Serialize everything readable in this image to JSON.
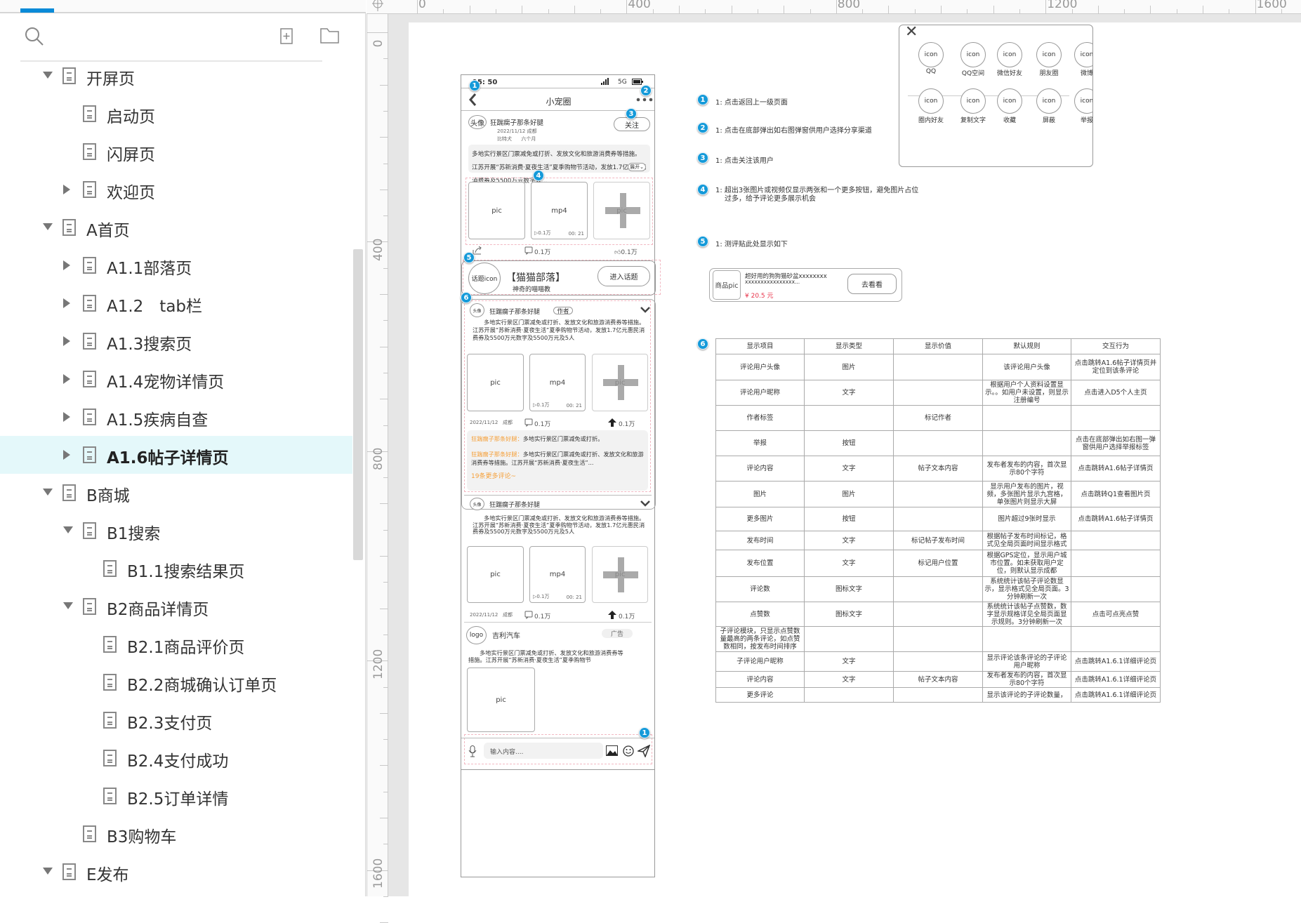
{
  "sidebar": {
    "items": [
      {
        "label": "开屏页",
        "level": 0,
        "state": "expanded"
      },
      {
        "label": "启动页",
        "level": 1,
        "state": "leaf"
      },
      {
        "label": "闪屏页",
        "level": 1,
        "state": "leaf"
      },
      {
        "label": "欢迎页",
        "level": 1,
        "state": "collapsed"
      },
      {
        "label": "A首页",
        "level": 0,
        "state": "expanded"
      },
      {
        "label": "A1.1部落页",
        "level": 1,
        "state": "collapsed"
      },
      {
        "label": "A1.2　tab栏",
        "level": 1,
        "state": "collapsed"
      },
      {
        "label": "A1.3搜索页",
        "level": 1,
        "state": "collapsed"
      },
      {
        "label": "A1.4宠物详情页",
        "level": 1,
        "state": "collapsed"
      },
      {
        "label": "A1.5疾病自查",
        "level": 1,
        "state": "collapsed"
      },
      {
        "label": "A1.6帖子详情页",
        "level": 1,
        "state": "collapsed",
        "selected": true
      },
      {
        "label": "B商城",
        "level": 0,
        "state": "expanded"
      },
      {
        "label": "B1搜索",
        "level": 1,
        "state": "expanded"
      },
      {
        "label": "B1.1搜索结果页",
        "level": 2,
        "state": "leaf"
      },
      {
        "label": "B2商品详情页",
        "level": 1,
        "state": "expanded"
      },
      {
        "label": "B2.1商品评价页",
        "level": 2,
        "state": "leaf"
      },
      {
        "label": "B2.2商城确认订单页",
        "level": 2,
        "state": "leaf"
      },
      {
        "label": "B2.3支付页",
        "level": 2,
        "state": "leaf"
      },
      {
        "label": "B2.4支付成功",
        "level": 2,
        "state": "leaf"
      },
      {
        "label": "B2.5订单详情",
        "level": 2,
        "state": "leaf"
      },
      {
        "label": "B3购物车",
        "level": 1,
        "state": "leaf"
      },
      {
        "label": "E发布",
        "level": 0,
        "state": "expanded"
      }
    ]
  },
  "rulers": {
    "top": [
      "0",
      "400",
      "800",
      "1200",
      "1600"
    ],
    "left": [
      "0",
      "400",
      "800",
      "1200",
      "1600"
    ]
  },
  "phone": {
    "time": "15: 50",
    "network": "5G",
    "title": "小宠圈",
    "post": {
      "avatar": "头像",
      "name": "狂踹瘸子那条好腿",
      "date": "2022/11/12  成都",
      "pet": "比特犬      六个月",
      "follow": "关注",
      "text": "多地实行景区门票减免或打折、发放文化和旅游消费券等措施。江苏开展“苏新消费·夏夜生活”夏季购物节活动，发放1.7亿元惠民消费券及5500万元数字人...",
      "expand": "展开⌄",
      "pic": "pic",
      "mp4": "mp4",
      "plays": "▷0.1万",
      "duration": "00: 21",
      "more": "pic",
      "comments": "0.1万",
      "likes": "0.1万"
    },
    "topic": {
      "icon": "话题icon",
      "title": "【猫猫部落】",
      "subtitle": "神奇的喵喵教",
      "button": "进入话题"
    },
    "comment1": {
      "avatar": "头像",
      "name": "狂踹瘸子那条好腿",
      "tag": "作者",
      "text": "多地实行景区门票减免或打折、发放文化和旅游消费券等措施。江苏开展“苏新消费·夏夜生活”夏季购物节活动，发放1.7亿元惠民消费券及5500万元数字及5500万元及5人",
      "pic": "pic",
      "mp4": "mp4",
      "plays": "▷0.1万",
      "duration": "00: 21",
      "more": "pic",
      "meta": "2022/11/12   成都",
      "comments": "0.1万",
      "likes": "0.1万",
      "replies": [
        {
          "name": "狂踹瘸子那条好腿：",
          "text": "多地实行景区门票减免或打折。"
        },
        {
          "name": "狂踹瘸子那条好腿：",
          "text": "多地实行景区门票减免或打折、发放文化和旅游消费券等措施。江苏开展“苏新消费·夏夜生活”..."
        }
      ],
      "more_replies": "19条更多评论~"
    },
    "comment2": {
      "avatar": "头像",
      "name": "狂踹瘸子那条好腿",
      "text": "多地实行景区门票减免或打折、发放文化和旅游消费券等措施。江苏开展“苏新消费·夏夜生活”夏季购物节活动，发放1.7亿元惠民消费券及5500万元数字及5500万元及5人",
      "pic": "pic",
      "mp4": "mp4",
      "plays": "▷0.1万",
      "duration": "00: 21",
      "more": "pic",
      "meta": "2022/11/12   成都",
      "comments": "0.1万",
      "likes": "0.1万"
    },
    "ad": {
      "logo": "logo",
      "name": "吉利汽车",
      "badge": "广告",
      "text": "多地实行景区门票减免或打折、发放文化和旅游消费券等措施。江苏开展“苏新消费·夏夜生活”夏季购物节",
      "pic": "pic"
    },
    "input": {
      "placeholder": "输入内容...."
    }
  },
  "annotations": [
    {
      "num": "1",
      "text": "1:  点击返回上一级页面"
    },
    {
      "num": "2",
      "text": "1:  点击在底部弹出如右图弹窗供用户选择分享渠道"
    },
    {
      "num": "3",
      "text": "1:  点击关注该用户"
    },
    {
      "num": "4",
      "text": "1:  超出3张图片或视频仅显示两张和一个更多按钮，避免图片占位",
      "text2": "过多，给予评论更多展示机会"
    },
    {
      "num": "5",
      "text": "1:  测评贴此处显示如下"
    },
    {
      "num": "6"
    }
  ],
  "markers": [
    "1",
    "2",
    "3",
    "4",
    "5",
    "6",
    "1"
  ],
  "product": {
    "pic": "商品pic",
    "name": "超好用的狗狗猫砂盆xxxxxxxx",
    "name2": "xxxxxxxxxxxxxxxx...",
    "price": "¥ 20.5 元",
    "button": "去看看",
    "price_color": "#e8334a"
  },
  "share": {
    "close": "✕",
    "row1": [
      {
        "icon": "icon",
        "label": "QQ"
      },
      {
        "icon": "icon",
        "label": "QQ空间"
      },
      {
        "icon": "icon",
        "label": "微信好友"
      },
      {
        "icon": "icon",
        "label": "朋友圈"
      },
      {
        "icon": "icon",
        "label": "微博"
      }
    ],
    "row2": [
      {
        "icon": "icon",
        "label": "圈内好友"
      },
      {
        "icon": "icon",
        "label": "复制文字"
      },
      {
        "icon": "icon",
        "label": "收藏"
      },
      {
        "icon": "icon",
        "label": "屏蔽"
      },
      {
        "icon": "icon",
        "label": "举报"
      }
    ]
  },
  "spec_table": {
    "headers": [
      "显示项目",
      "显示类型",
      "显示价值",
      "默认规则",
      "交互行为"
    ],
    "rows": [
      [
        "评论用户头像",
        "图片",
        "",
        "该评论用户头像",
        "点击跳转A1.6帖子详情页并定位到该条评论"
      ],
      [
        "评论用户昵称",
        "文字",
        "",
        "根据用户个人资料设置显示。。如用户未设置，则显示注册编号",
        "点击进入D5个人主页"
      ],
      [
        "作者标签",
        "",
        "标记作者",
        "",
        ""
      ],
      [
        "举报",
        "按钮",
        "",
        "",
        "点击在底部弹出如右图一弹窗供用户选择举报标签"
      ],
      [
        "评论内容",
        "文字",
        "帖子文本内容",
        "发布者发布的内容，首次显示80个字符",
        "点击跳转A1.6帖子详情页"
      ],
      [
        "图片",
        "图片",
        "",
        "显示用户发布的图片，视频，多张图片显示九宫格，单张图片则显示大屏",
        "点击跳转Q1查看图片页"
      ],
      [
        "更多图片",
        "按钮",
        "",
        "图片超过9张时显示",
        "点击跳转A1.6帖子详情页"
      ],
      [
        "发布时间",
        "文字",
        "标记帖子发布时间",
        "根据帖子发布时间标记，格式见全局页面时间显示格式",
        ""
      ],
      [
        "发布位置",
        "文字",
        "标记用户位置",
        "根据GPS定位，显示用户城市位置。如未获取用户定位，则默认显示成都",
        ""
      ],
      [
        "评论数",
        "图标文字",
        "",
        "系统统计该帖子评论数显示，显示格式见全局页面。3分钟刷新一次",
        ""
      ],
      [
        "点赞数",
        "图标文字",
        "",
        "系统统计该帖子点赞数，数字显示规格详见全局页面显示规则。3分钟刷新一次",
        "点击可点亮点赞"
      ],
      [
        "子评论模块，只显示点赞数量最高的两条评论，如点赞数相同，按发布时间排序",
        "",
        "",
        "",
        ""
      ],
      [
        "子评论用户昵称",
        "文字",
        "",
        "显示评论该条评论的子评论用户昵称",
        "点击跳转A1.6.1详细评论页"
      ],
      [
        "评论内容",
        "文字",
        "帖子文本内容",
        "发布者发布的内容，首次显示80个字符",
        "点击跳转A1.6.1详细评论页"
      ],
      [
        "更多评论",
        "",
        "",
        "显示该评论的子评论数量，",
        "点击跳转A1.6.1详细评论页"
      ]
    ]
  },
  "colors": {
    "accent": "#0a8ad8",
    "marker": "#159ad9",
    "selected_row": "#e4f8fa",
    "reply_name": "#f5a03a"
  }
}
